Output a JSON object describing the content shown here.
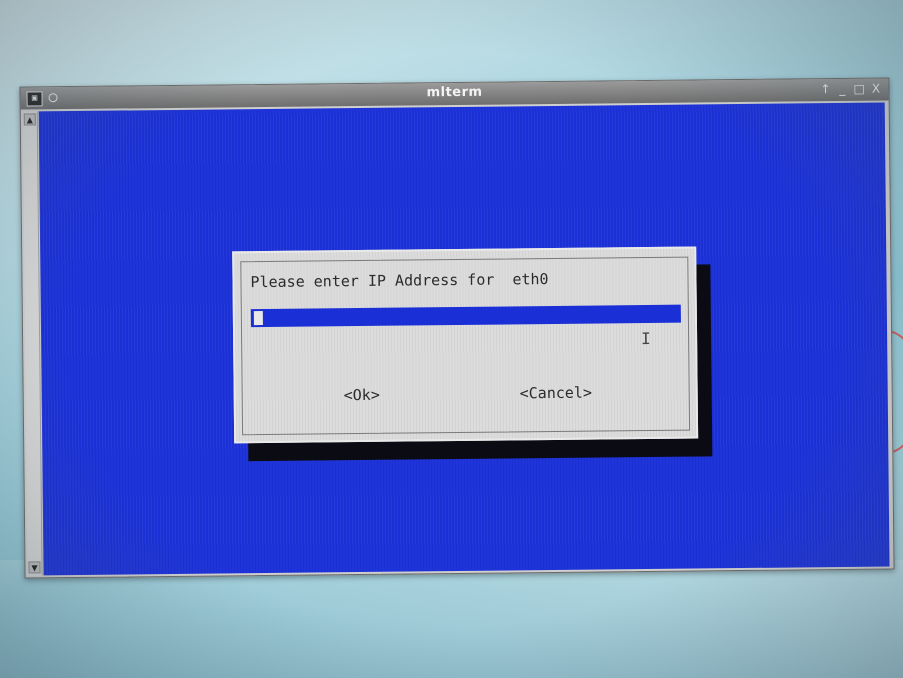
{
  "window": {
    "title": "mlterm",
    "controls": {
      "pin": "↑",
      "minimize": "_",
      "maximize": "□",
      "close": "X"
    }
  },
  "scrollbar": {
    "up": "▲",
    "down": "▼"
  },
  "dialog": {
    "prompt": "Please enter IP Address for  eth0",
    "ip_value": "",
    "ok_label": "<Ok>",
    "cancel_label": "<Cancel>"
  },
  "colors": {
    "terminal_bg": "#1a2fd6",
    "dialog_bg": "#dcdcdc",
    "shadow": "#0b0b14"
  }
}
